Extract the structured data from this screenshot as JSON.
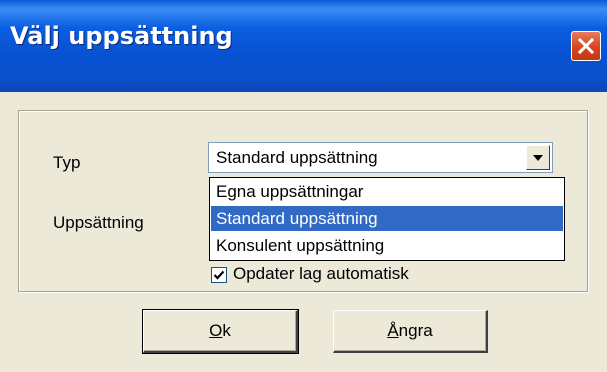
{
  "window": {
    "title": "Välj uppsättning",
    "close_icon": "close-icon"
  },
  "form": {
    "type_label": "Typ",
    "setup_label": "Uppsättning",
    "type_combo": {
      "value": "Standard uppsättning",
      "options": [
        "Egna uppsättningar",
        "Standard uppsättning",
        "Konsulent uppsättning"
      ],
      "selected_index": 1,
      "open": true
    },
    "auto_update": {
      "label": "Opdater lag automatisk",
      "checked": true
    }
  },
  "buttons": {
    "ok": {
      "mnemonic": "O",
      "rest": "k"
    },
    "cancel": {
      "mnemonic": "Å",
      "rest": "ngra"
    }
  },
  "colors": {
    "titlebar": "#0b5fe0",
    "selection": "#316ac5",
    "close_button": "#d6451e",
    "dialog_bg": "#ece9d8"
  }
}
